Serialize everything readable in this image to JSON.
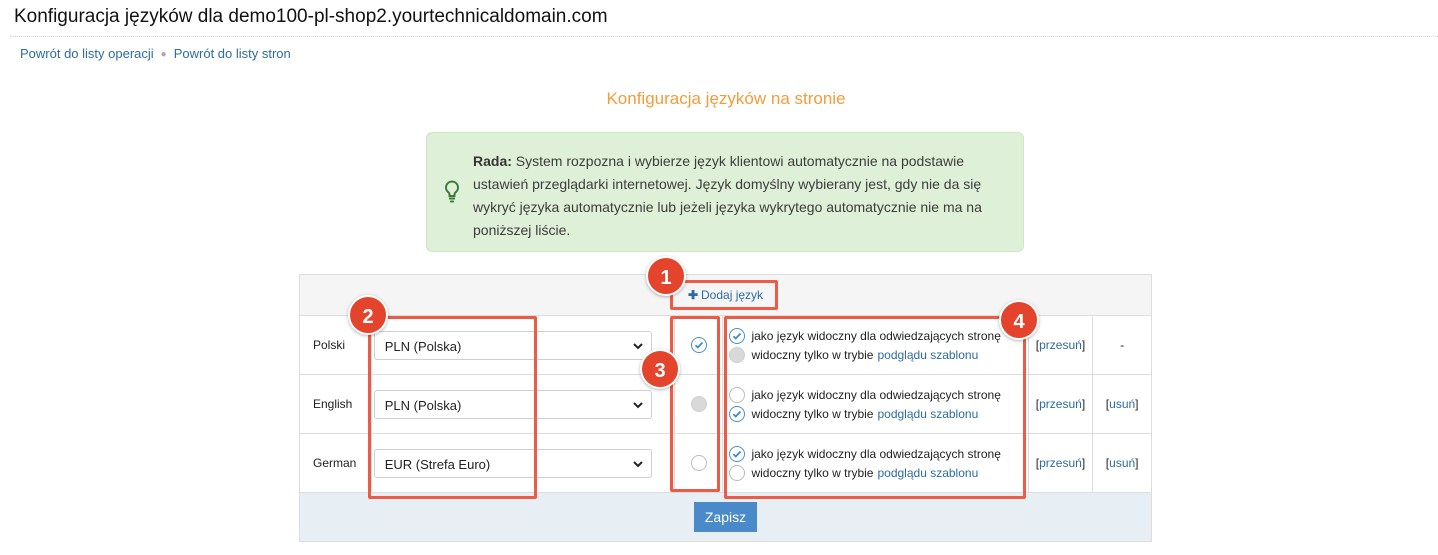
{
  "page": {
    "title": "Konfiguracja języków dla demo100-pl-shop2.yourtechnicaldomain.com",
    "heading": "Konfiguracja języków na stronie"
  },
  "breadcrumb": {
    "items": [
      "Powrót do listy operacji",
      "Powrót do listy stron"
    ]
  },
  "tip": {
    "label": "Rada:",
    "text": " System rozpozna i wybierze język klientowi automatycznie na podstawie ustawień przeglądarki internetowej. Język domyślny wybierany jest, gdy nie da się wykryć języka automatycznie lub jeżeli języka wykrytego automatycznie nie ma na poniższej liście.",
    "icon": "lightbulb-icon",
    "color": "#dff0d8"
  },
  "table": {
    "add_label": "Dodaj język",
    "visible_label": "jako język widoczny dla odwiedzających stronę",
    "preview_prefix": "widoczny tylko w trybie",
    "preview_link": "podglądu szablonu",
    "move_label": "przesuń",
    "delete_label": "usuń",
    "bracket_open": "[",
    "bracket_close": "]",
    "dash": "-",
    "rows": [
      {
        "name": "Polski",
        "currency": "PLN (Polska)",
        "default_state": "checked",
        "visibility": "visible"
      },
      {
        "name": "English",
        "currency": "PLN (Polska)",
        "default_state": "disabled",
        "visibility": "preview"
      },
      {
        "name": "German",
        "currency": "EUR (Strefa Euro)",
        "default_state": "empty",
        "visibility": "visible"
      }
    ],
    "save_label": "Zapisz"
  },
  "annotations": {
    "badges": [
      "1",
      "2",
      "3",
      "4"
    ],
    "color": "#ec5b46"
  }
}
